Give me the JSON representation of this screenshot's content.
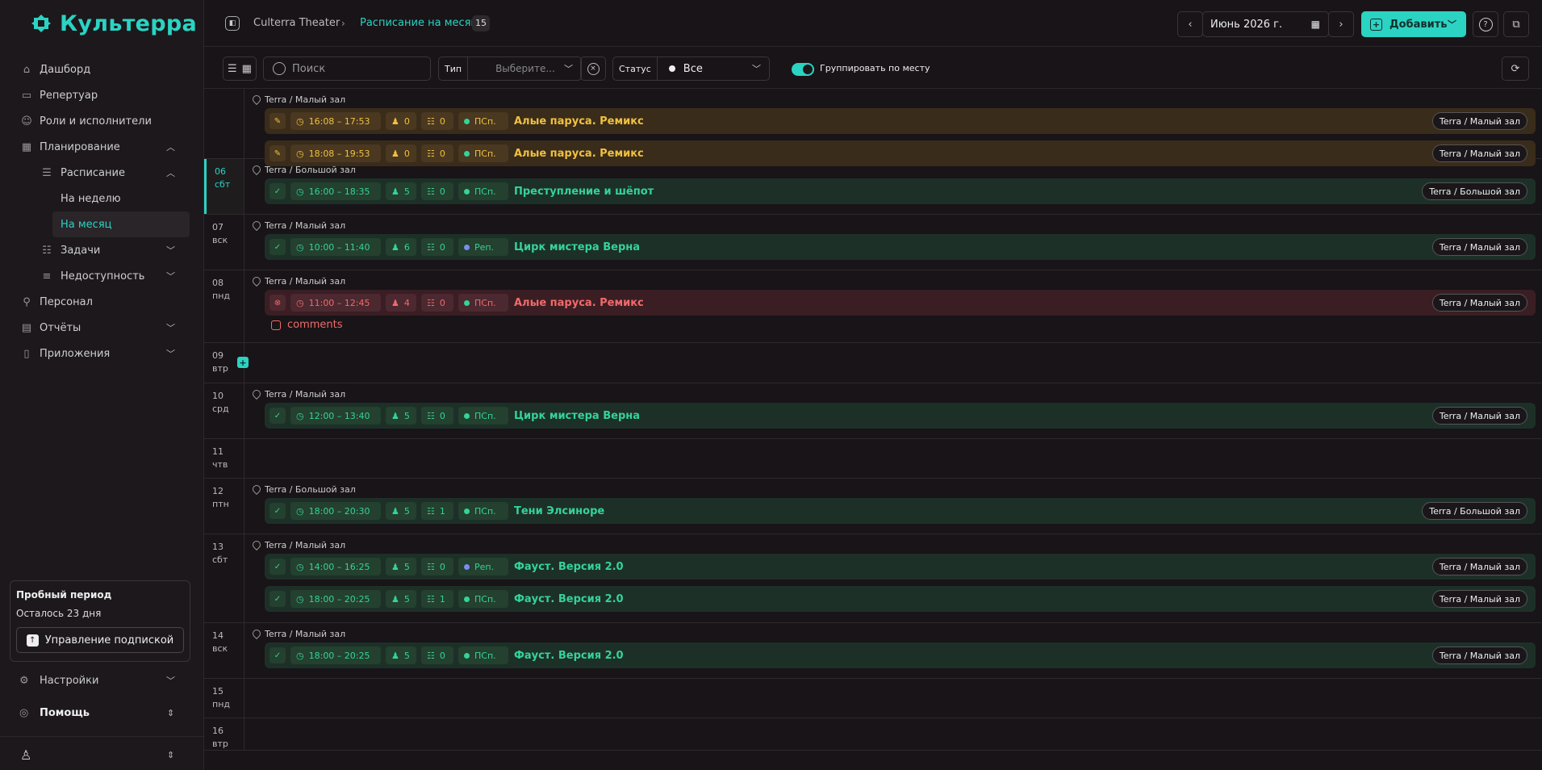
{
  "app": {
    "name": "Культерра"
  },
  "nav": {
    "dashboard": "Дашборд",
    "repertoire": "Репертуар",
    "roles": "Роли и исполнители",
    "planning": "Планирование",
    "schedule": "Расписание",
    "week": "На неделю",
    "month": "На месяц",
    "tasks": "Задачи",
    "unavailability": "Недоступность",
    "staff": "Персонал",
    "reports": "Отчёты",
    "apps": "Приложения",
    "settings": "Настройки",
    "help": "Помощь"
  },
  "trial": {
    "title": "Пробный период",
    "remaining": "Осталось 23 дня",
    "button": "Управление подпиской"
  },
  "header": {
    "breadcrumb_root": "Culterra Theater",
    "breadcrumb_current": "Расписание на месяц",
    "count": "15",
    "month": "Июнь 2026 г.",
    "add_label": "Добавить"
  },
  "toolbar": {
    "search_placeholder": "Поиск",
    "type_label": "Тип",
    "type_placeholder": "Выберите...",
    "status_label": "Статус",
    "status_value": "Все",
    "group_label": "Группировать по месту"
  },
  "colors": {
    "accent": "#2bd3c3",
    "green": "#34d399",
    "yellow": "#f0c040",
    "red": "#f26a6a",
    "blue": "#7b8cf0"
  },
  "days": [
    {
      "num": "",
      "dow": "",
      "venue": "Terra / Малый зал",
      "events": [
        {
          "status": "yellow",
          "time": "16:08 – 17:53",
          "people": "0",
          "tasks": "0",
          "kind": "ПСп.",
          "kind_color": "green",
          "title": "Алые паруса. Ремикс",
          "venue": "Terra / Малый зал"
        },
        {
          "status": "yellow",
          "time": "18:08 – 19:53",
          "people": "0",
          "tasks": "0",
          "kind": "ПСп.",
          "kind_color": "green",
          "title": "Алые паруса. Ремикс",
          "venue": "Terra / Малый зал"
        }
      ]
    },
    {
      "num": "06",
      "dow": "сбт",
      "selected": true,
      "venue": "Terra / Большой зал",
      "events": [
        {
          "status": "green",
          "time": "16:00 – 18:35",
          "people": "5",
          "tasks": "0",
          "kind": "ПСп.",
          "kind_color": "green",
          "title": "Преступление и шёпот",
          "venue": "Terra / Большой зал"
        }
      ]
    },
    {
      "num": "07",
      "dow": "вск",
      "venue": "Terra / Малый зал",
      "events": [
        {
          "status": "green",
          "time": "10:00 – 11:40",
          "people": "6",
          "tasks": "0",
          "kind": "Реп.",
          "kind_color": "blue",
          "title": "Цирк мистера Верна",
          "venue": "Terra / Малый зал"
        }
      ]
    },
    {
      "num": "08",
      "dow": "пнд",
      "venue": "Terra / Малый зал",
      "comments": "comments",
      "events": [
        {
          "status": "red",
          "time": "11:00 – 12:45",
          "people": "4",
          "tasks": "0",
          "kind": "ПСп.",
          "kind_color": "green",
          "title": "Алые паруса. Ремикс",
          "venue": "Terra / Малый зал"
        }
      ]
    },
    {
      "num": "09",
      "dow": "втр",
      "add": true,
      "events": []
    },
    {
      "num": "10",
      "dow": "срд",
      "venue": "Terra / Малый зал",
      "events": [
        {
          "status": "green",
          "time": "12:00 – 13:40",
          "people": "5",
          "tasks": "0",
          "kind": "ПСп.",
          "kind_color": "green",
          "title": "Цирк мистера Верна",
          "venue": "Terra / Малый зал"
        }
      ]
    },
    {
      "num": "11",
      "dow": "чтв",
      "events": []
    },
    {
      "num": "12",
      "dow": "птн",
      "venue": "Terra / Большой зал",
      "events": [
        {
          "status": "green",
          "time": "18:00 – 20:30",
          "people": "5",
          "tasks": "1",
          "kind": "ПСп.",
          "kind_color": "green",
          "title": "Тени Элсиноре",
          "venue": "Terra / Большой зал"
        }
      ]
    },
    {
      "num": "13",
      "dow": "сбт",
      "venue": "Terra / Малый зал",
      "events": [
        {
          "status": "green",
          "time": "14:00 – 16:25",
          "people": "5",
          "tasks": "0",
          "kind": "Реп.",
          "kind_color": "blue",
          "title": "Фауст. Версия 2.0",
          "venue": "Terra / Малый зал"
        },
        {
          "status": "green",
          "time": "18:00 – 20:25",
          "people": "5",
          "tasks": "1",
          "kind": "ПСп.",
          "kind_color": "green",
          "title": "Фауст. Версия 2.0",
          "venue": "Terra / Малый зал"
        }
      ]
    },
    {
      "num": "14",
      "dow": "вск",
      "venue": "Terra / Малый зал",
      "events": [
        {
          "status": "green",
          "time": "18:00 – 20:25",
          "people": "5",
          "tasks": "0",
          "kind": "ПСп.",
          "kind_color": "green",
          "title": "Фауст. Версия 2.0",
          "venue": "Terra / Малый зал"
        }
      ]
    },
    {
      "num": "15",
      "dow": "пнд",
      "events": []
    },
    {
      "num": "16",
      "dow": "втр",
      "events": []
    }
  ]
}
